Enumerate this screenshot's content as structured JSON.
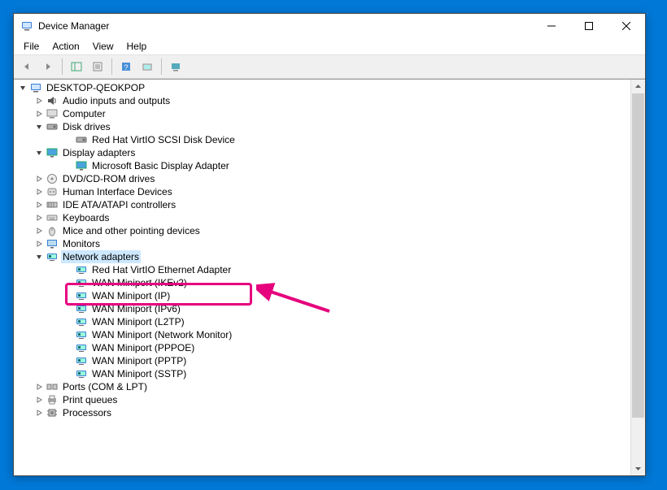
{
  "window": {
    "title": "Device Manager"
  },
  "menu": {
    "file": "File",
    "action": "Action",
    "view": "View",
    "help": "Help"
  },
  "tree": {
    "root": "DESKTOP-QEOKPOP",
    "items": [
      {
        "label": "Audio inputs and outputs",
        "icon": "audio",
        "expanded": false
      },
      {
        "label": "Computer",
        "icon": "computer",
        "expanded": false
      },
      {
        "label": "Disk drives",
        "icon": "disk",
        "expanded": true,
        "children": [
          {
            "label": "Red Hat VirtIO SCSI Disk Device",
            "icon": "disk"
          }
        ]
      },
      {
        "label": "Display adapters",
        "icon": "display",
        "expanded": true,
        "children": [
          {
            "label": "Microsoft Basic Display Adapter",
            "icon": "display"
          }
        ]
      },
      {
        "label": "DVD/CD-ROM drives",
        "icon": "cdrom",
        "expanded": false
      },
      {
        "label": "Human Interface Devices",
        "icon": "hid",
        "expanded": false
      },
      {
        "label": "IDE ATA/ATAPI controllers",
        "icon": "ide",
        "expanded": false
      },
      {
        "label": "Keyboards",
        "icon": "keyboard",
        "expanded": false
      },
      {
        "label": "Mice and other pointing devices",
        "icon": "mouse",
        "expanded": false
      },
      {
        "label": "Monitors",
        "icon": "monitor",
        "expanded": false
      },
      {
        "label": "Network adapters",
        "icon": "network",
        "expanded": true,
        "selected": true,
        "children": [
          {
            "label": "Red Hat VirtIO Ethernet Adapter",
            "icon": "network",
            "highlighted": true
          },
          {
            "label": "WAN Miniport (IKEv2)",
            "icon": "network"
          },
          {
            "label": "WAN Miniport (IP)",
            "icon": "network"
          },
          {
            "label": "WAN Miniport (IPv6)",
            "icon": "network"
          },
          {
            "label": "WAN Miniport (L2TP)",
            "icon": "network"
          },
          {
            "label": "WAN Miniport (Network Monitor)",
            "icon": "network"
          },
          {
            "label": "WAN Miniport (PPPOE)",
            "icon": "network"
          },
          {
            "label": "WAN Miniport (PPTP)",
            "icon": "network"
          },
          {
            "label": "WAN Miniport (SSTP)",
            "icon": "network"
          }
        ]
      },
      {
        "label": "Ports (COM & LPT)",
        "icon": "ports",
        "expanded": false
      },
      {
        "label": "Print queues",
        "icon": "printer",
        "expanded": false
      },
      {
        "label": "Processors",
        "icon": "cpu",
        "expanded": false,
        "clipped": true
      }
    ]
  },
  "annotation": {
    "color": "#e6007e"
  }
}
